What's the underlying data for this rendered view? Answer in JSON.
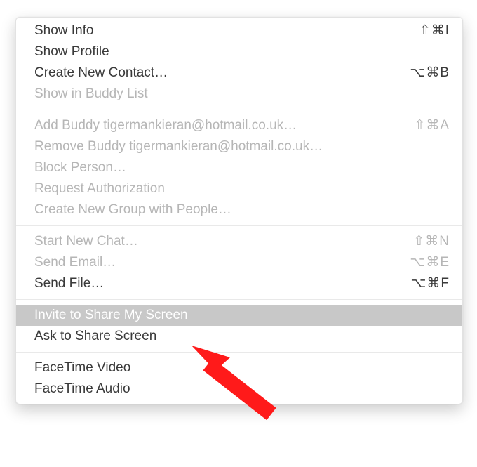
{
  "accent_highlight": "#c8c8c8",
  "arrow_color": "#ff1a1a",
  "sections": [
    {
      "items": [
        {
          "id": "show-info",
          "label": "Show Info",
          "shortcut": "⇧⌘I",
          "disabled": false,
          "highlight": false
        },
        {
          "id": "show-profile",
          "label": "Show Profile",
          "shortcut": "",
          "disabled": false,
          "highlight": false
        },
        {
          "id": "create-new-contact",
          "label": "Create New Contact…",
          "shortcut": "⌥⌘B",
          "disabled": false,
          "highlight": false
        },
        {
          "id": "show-in-buddy-list",
          "label": "Show in Buddy List",
          "shortcut": "",
          "disabled": true,
          "highlight": false
        }
      ]
    },
    {
      "items": [
        {
          "id": "add-buddy",
          "label": "Add Buddy tigermankieran@hotmail.co.uk…",
          "shortcut": "⇧⌘A",
          "disabled": true,
          "highlight": false
        },
        {
          "id": "remove-buddy",
          "label": "Remove Buddy tigermankieran@hotmail.co.uk…",
          "shortcut": "",
          "disabled": true,
          "highlight": false
        },
        {
          "id": "block-person",
          "label": "Block Person…",
          "shortcut": "",
          "disabled": true,
          "highlight": false
        },
        {
          "id": "request-auth",
          "label": "Request Authorization",
          "shortcut": "",
          "disabled": true,
          "highlight": false
        },
        {
          "id": "create-new-group",
          "label": "Create New Group with People…",
          "shortcut": "",
          "disabled": true,
          "highlight": false
        }
      ]
    },
    {
      "items": [
        {
          "id": "start-new-chat",
          "label": "Start New Chat…",
          "shortcut": "⇧⌘N",
          "disabled": true,
          "highlight": false
        },
        {
          "id": "send-email",
          "label": "Send Email…",
          "shortcut": "⌥⌘E",
          "disabled": true,
          "highlight": false
        },
        {
          "id": "send-file",
          "label": "Send File…",
          "shortcut": "⌥⌘F",
          "disabled": false,
          "highlight": false
        }
      ]
    },
    {
      "items": [
        {
          "id": "invite-share-my-screen",
          "label": "Invite to Share My Screen",
          "shortcut": "",
          "disabled": false,
          "highlight": true
        },
        {
          "id": "ask-share-screen",
          "label": "Ask to Share Screen",
          "shortcut": "",
          "disabled": false,
          "highlight": false
        }
      ]
    },
    {
      "items": [
        {
          "id": "facetime-video",
          "label": "FaceTime Video",
          "shortcut": "",
          "disabled": false,
          "highlight": false
        },
        {
          "id": "facetime-audio",
          "label": "FaceTime Audio",
          "shortcut": "",
          "disabled": false,
          "highlight": false
        }
      ]
    }
  ]
}
